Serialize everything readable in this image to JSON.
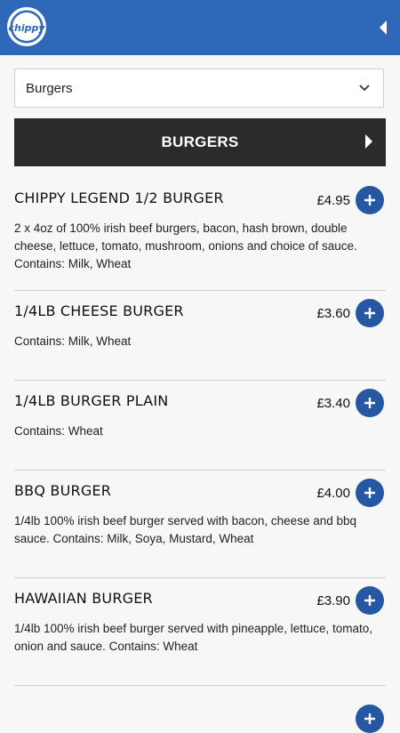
{
  "app": {
    "logo_text": "chippy",
    "brand_color": "#2f68b8"
  },
  "category_select": {
    "value": "Burgers"
  },
  "category_header": {
    "title": "BURGERS"
  },
  "add_icon": "plus-icon",
  "items": [
    {
      "name": "CHIPPY LEGEND 1/2 BURGER",
      "price": "£4.95",
      "description": "2 x 4oz of 100% irish beef burgers, bacon, hash brown, double cheese, lettuce, tomato, mushroom, onions and choice of sauce. Contains: Milk, Wheat"
    },
    {
      "name": "1/4LB CHEESE BURGER",
      "price": "£3.60",
      "description": "Contains: Milk, Wheat"
    },
    {
      "name": "1/4LB BURGER PLAIN",
      "price": "£3.40",
      "description": "Contains: Wheat"
    },
    {
      "name": "BBQ BURGER",
      "price": "£4.00",
      "description": "1/4lb 100% irish beef burger served with bacon, cheese and bbq sauce. Contains: Milk, Soya, Mustard, Wheat"
    },
    {
      "name": "HAWAIIAN BURGER",
      "price": "£3.90",
      "description": "1/4lb 100% irish beef burger served with pineapple, lettuce, tomato, onion and sauce. Contains: Wheat"
    },
    {
      "name": "",
      "price": "",
      "description": ""
    }
  ]
}
